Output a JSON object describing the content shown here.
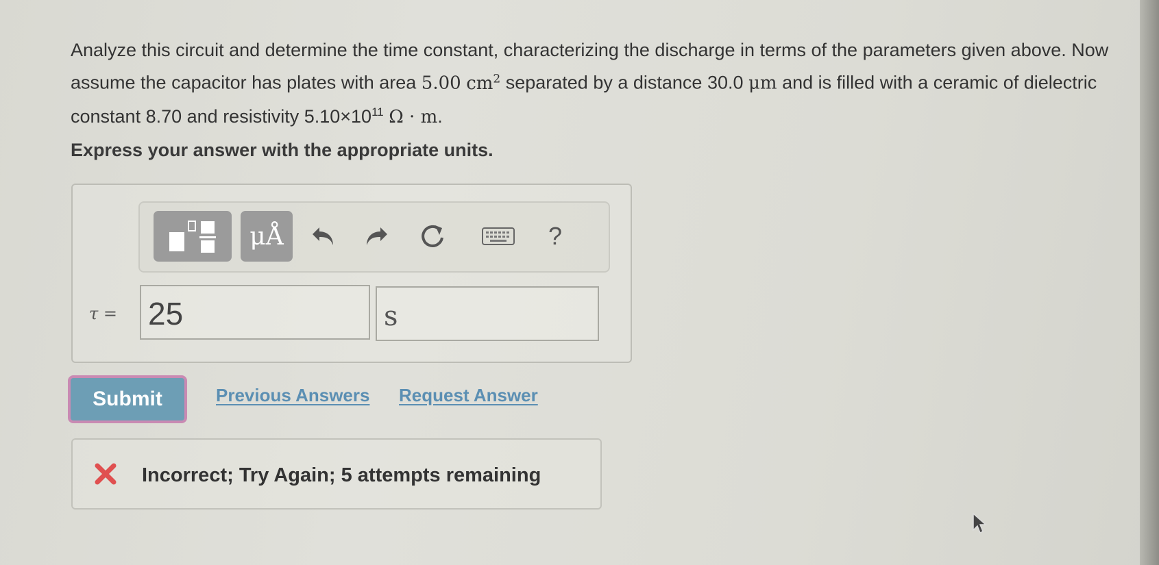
{
  "question": {
    "part1": "Analyze this circuit and determine the time constant, characterizing the discharge in terms of the parameters given above. Now assume the capacitor has plates with area ",
    "area_value": "5.00",
    "area_unit": "cm",
    "area_exp": "2",
    "part2": " separated by a distance ",
    "distance_value": "30.0",
    "distance_unit": "μm",
    "part3": " and is filled with a ceramic of dielectric constant ",
    "dielectric": "8.70",
    "part4": " and resistivity ",
    "resistivity_mantissa": "5.10×10",
    "resistivity_exp": "11",
    "resistivity_unit": "Ω · m",
    "end": "."
  },
  "instruction": "Express your answer with the appropriate units.",
  "toolbar": {
    "units_label": "μÅ",
    "help_label": "?",
    "icons": [
      "templates-icon",
      "undo-icon",
      "redo-icon",
      "reset-icon",
      "keyboard-icon"
    ]
  },
  "answer": {
    "variable": "τ",
    "equals": "=",
    "value": "25",
    "unit": "s"
  },
  "actions": {
    "submit_label": "Submit",
    "previous_answers_label": "Previous Answers",
    "request_answer_label": "Request Answer"
  },
  "feedback": {
    "message": "Incorrect; Try Again; 5 attempts remaining",
    "status_color": "#e05050"
  },
  "colors": {
    "submit_bg": "#6d9eb5",
    "link": "#5b8fb3",
    "toolbar_button": "#9b9b9b"
  }
}
